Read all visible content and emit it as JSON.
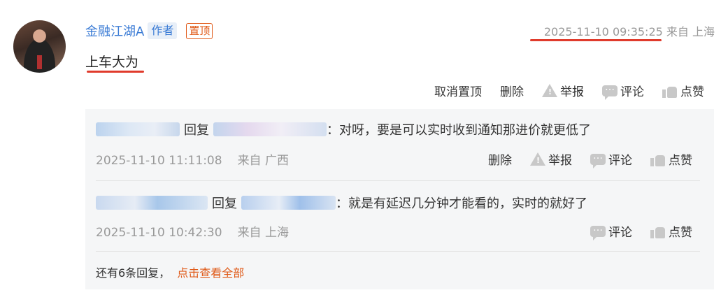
{
  "comment": {
    "author": "金融江湖A",
    "author_tag": "作者",
    "pin_tag": "置顶",
    "timestamp": "2025-11-10 09:35:25",
    "location": "来自 上海",
    "content": "上车大为",
    "actions": {
      "unpin": "取消置顶",
      "delete": "删除",
      "report": "举报",
      "comment": "评论",
      "like": "点赞"
    }
  },
  "replies": [
    {
      "reply_word": "回复",
      "text": "：对呀，要是可以实时收到通知那进价就更低了",
      "timestamp": "2025-11-10 11:11:08",
      "location": "来自 广西",
      "actions": {
        "delete": "删除",
        "report": "举报",
        "comment": "评论",
        "like": "点赞"
      }
    },
    {
      "reply_word": "回复",
      "text": "：就是有延迟几分钟才能看的，实时的就好了",
      "timestamp": "2025-11-10 10:42:30",
      "location": "来自 上海",
      "actions": {
        "comment": "评论",
        "like": "点赞"
      }
    }
  ],
  "more": {
    "count_text": "还有6条回复，",
    "link_text": "点击查看全部"
  },
  "colors": {
    "accent_blue": "#3a7bd5",
    "accent_orange": "#e05a18",
    "highlight_red": "#e03b2c"
  }
}
